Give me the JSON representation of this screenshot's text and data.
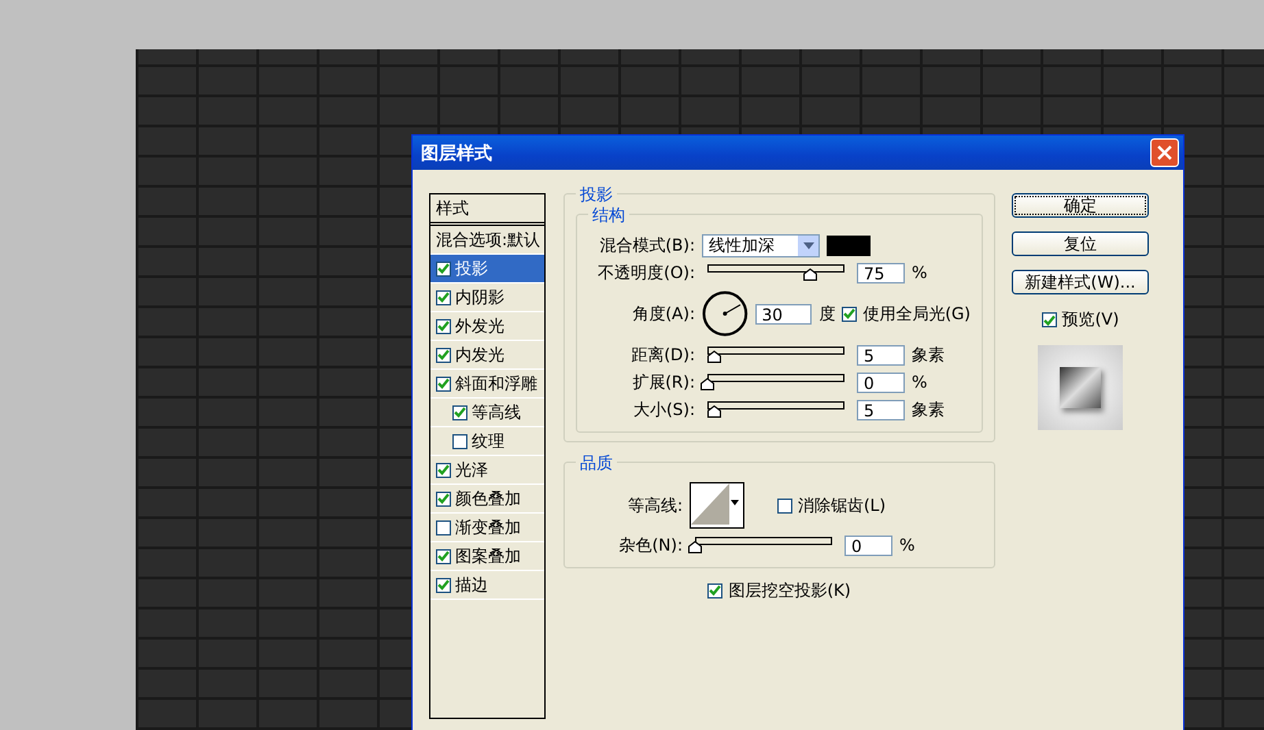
{
  "window": {
    "title": "图层样式"
  },
  "styles": {
    "header": "样式",
    "items": [
      {
        "label": "混合选项:默认",
        "kind": "plain",
        "selected": false
      },
      {
        "label": "投影",
        "kind": "check",
        "checked": true,
        "selected": true
      },
      {
        "label": "内阴影",
        "kind": "check",
        "checked": true,
        "selected": false
      },
      {
        "label": "外发光",
        "kind": "check",
        "checked": true,
        "selected": false
      },
      {
        "label": "内发光",
        "kind": "check",
        "checked": true,
        "selected": false
      },
      {
        "label": "斜面和浮雕",
        "kind": "check",
        "checked": true,
        "selected": false,
        "children": [
          {
            "label": "等高线",
            "kind": "check",
            "checked": true,
            "selected": false
          },
          {
            "label": "纹理",
            "kind": "check",
            "checked": false,
            "selected": false
          }
        ]
      },
      {
        "label": "光泽",
        "kind": "check",
        "checked": true,
        "selected": false
      },
      {
        "label": "颜色叠加",
        "kind": "check",
        "checked": true,
        "selected": false
      },
      {
        "label": "渐变叠加",
        "kind": "check",
        "checked": false,
        "selected": false
      },
      {
        "label": "图案叠加",
        "kind": "check",
        "checked": true,
        "selected": false
      },
      {
        "label": "描边",
        "kind": "check",
        "checked": true,
        "selected": false
      }
    ]
  },
  "panel": {
    "title": "投影",
    "structure": {
      "title": "结构",
      "blend_mode": {
        "label": "混合模式(B):",
        "value": "线性加深",
        "color": "#000000"
      },
      "opacity": {
        "label": "不透明度(O):",
        "level": 0.75,
        "value": "75",
        "unit": "%"
      },
      "angle": {
        "label": "角度(A):",
        "value": "30",
        "unit": "度",
        "global_light": {
          "label": "使用全局光(G)",
          "checked": true
        }
      },
      "sliders": [
        {
          "label": "距离(D):",
          "level": 0.05,
          "value": "5",
          "unit": "象素"
        },
        {
          "label": "扩展(R):",
          "level": 0,
          "value": "0",
          "unit": "%"
        },
        {
          "label": "大小(S):",
          "level": 0.05,
          "value": "5",
          "unit": "象素"
        }
      ]
    },
    "quality": {
      "title": "品质",
      "contour": {
        "label": "等高线:"
      },
      "anti_alias": {
        "label": "消除锯齿(L)",
        "checked": false
      },
      "noise": {
        "label": "杂色(N):",
        "level": 0,
        "value": "0",
        "unit": "%"
      }
    },
    "knockout": {
      "label": "图层挖空投影(K)",
      "checked": true
    }
  },
  "buttons": [
    {
      "label": "确定",
      "default": true
    },
    {
      "label": "复位",
      "default": false
    },
    {
      "label": "新建样式(W)...",
      "default": false
    }
  ],
  "preview": {
    "label": "预览(V)",
    "checked": true
  }
}
